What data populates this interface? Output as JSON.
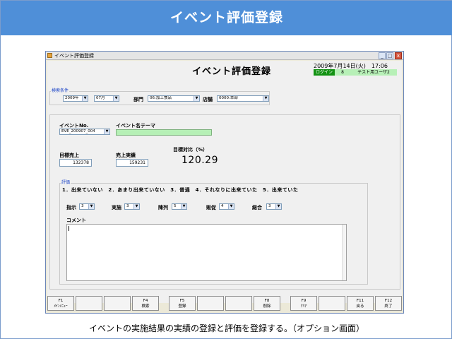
{
  "banner": {
    "title": "イベント評価登録"
  },
  "caption": "イベントの実施結果の実績の登録と評価を登録する。（オプション画面）",
  "window": {
    "title": "イベント評価登録",
    "controls": {
      "minimize": "_",
      "maximize": "□",
      "close": "x"
    }
  },
  "form": {
    "title": "イベント評価登録",
    "datetime": "2009年7月14日(火)　17:06",
    "login": {
      "label": "ログイン",
      "id": "8",
      "user": "テスト用ユーザ2"
    }
  },
  "search": {
    "legend": "検索条件",
    "year": "2009年",
    "month": "07月",
    "dept_label": "部門",
    "dept": "06:加工食品",
    "store_label": "店舗",
    "store": "0000:本部"
  },
  "event": {
    "no_label": "イベントNo.",
    "no_value": "EVE_200907_004",
    "name_label": "イベント名テーマ",
    "name_value": "",
    "target_sales_label": "目標売上",
    "target_sales": "132378",
    "actual_sales_label": "売上実績",
    "actual_sales": "159231",
    "ratio_label": "目標対比（%）",
    "ratio": "120.29"
  },
  "evaluation": {
    "legend": "評価",
    "scale": "1．出来ていない　2．あまり出来ていない　3．普通　4．それなりに出来ていた　5．出来ていた",
    "items": [
      {
        "label": "指示",
        "value": "3"
      },
      {
        "label": "実施",
        "value": "3"
      },
      {
        "label": "陳列",
        "value": "5"
      },
      {
        "label": "販促",
        "value": "4"
      },
      {
        "label": "総合",
        "value": "3"
      }
    ],
    "comment_label": "コメント",
    "comment": ""
  },
  "fkeys": [
    {
      "key": "F1",
      "label": "ﾒｲﾝﾒﾆｭｰ"
    },
    {
      "key": "",
      "label": ""
    },
    {
      "key": "",
      "label": ""
    },
    {
      "key": "F4",
      "label": "検索"
    },
    {
      "key": "F5",
      "label": "登録"
    },
    {
      "key": "",
      "label": ""
    },
    {
      "key": "",
      "label": ""
    },
    {
      "key": "F8",
      "label": "削除"
    },
    {
      "key": "F9",
      "label": "ｸﾘｱ"
    },
    {
      "key": "",
      "label": ""
    },
    {
      "key": "F11",
      "label": "戻る"
    },
    {
      "key": "F12",
      "label": "終了"
    }
  ],
  "colors": {
    "banner": "#4f8fd8",
    "login_label": "#129212",
    "highlight_field": "#b6f0b6",
    "legend_text": "#1a43c7"
  }
}
